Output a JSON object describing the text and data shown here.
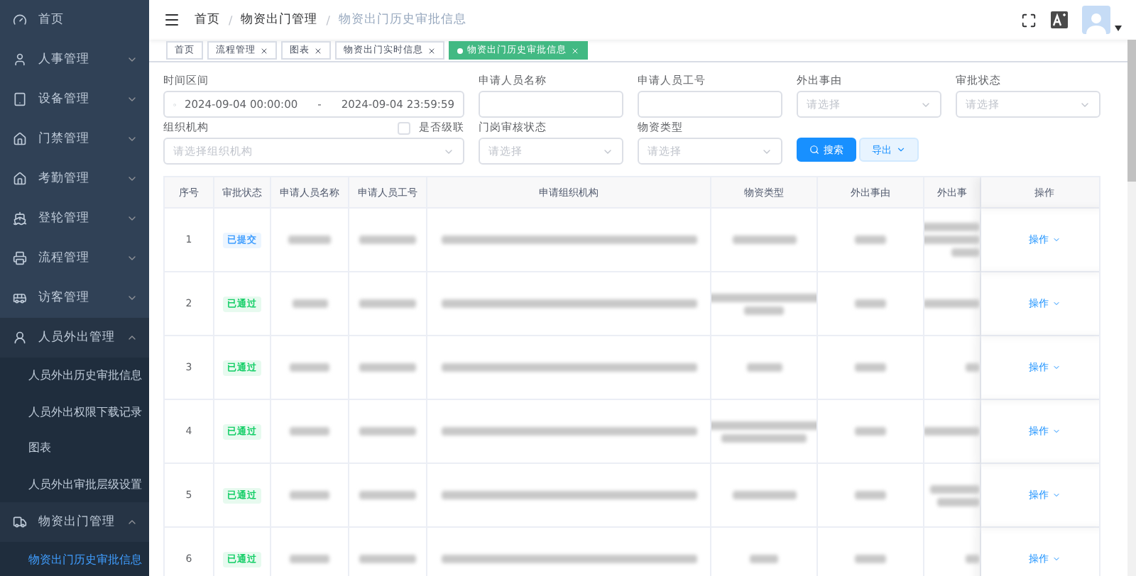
{
  "sidebar": {
    "items": [
      {
        "label": "首页"
      },
      {
        "label": "人事管理",
        "expanded": false
      },
      {
        "label": "设备管理",
        "expanded": false
      },
      {
        "label": "门禁管理",
        "expanded": false
      },
      {
        "label": "考勤管理",
        "expanded": false
      },
      {
        "label": "登轮管理",
        "expanded": false
      },
      {
        "label": "流程管理",
        "expanded": false
      },
      {
        "label": "访客管理",
        "expanded": false
      },
      {
        "label": "人员外出管理",
        "expanded": true,
        "children": [
          {
            "label": "人员外出历史审批信息",
            "selected": false
          },
          {
            "label": "人员外出权限下载记录",
            "selected": false
          },
          {
            "label": "图表",
            "selected": false
          },
          {
            "label": "人员外出审批层级设置",
            "selected": false
          }
        ]
      },
      {
        "label": "物资出门管理",
        "expanded": true,
        "children": [
          {
            "label": "物资出门历史审批信息",
            "selected": true
          }
        ]
      }
    ]
  },
  "breadcrumb": {
    "separator": "/",
    "items": [
      "首页",
      "物资出门管理",
      "物资出门历史审批信息"
    ]
  },
  "tags": [
    {
      "label": "首页",
      "closable": false,
      "selected": false
    },
    {
      "label": "流程管理",
      "closable": true,
      "selected": false
    },
    {
      "label": "图表",
      "closable": true,
      "selected": false
    },
    {
      "label": "物资出门实时信息",
      "closable": true,
      "selected": false
    },
    {
      "label": "物资出门历史审批信息",
      "closable": true,
      "selected": true
    }
  ],
  "filters": {
    "date_range": {
      "label": "时间区间",
      "start": "2024-09-04 00:00:00",
      "separator": "-",
      "end": "2024-09-04 23:59:59"
    },
    "row1": [
      {
        "label": "申请人员名称",
        "kind": "input"
      },
      {
        "label": "申请人员工号",
        "kind": "input"
      },
      {
        "label": "外出事由",
        "kind": "select",
        "placeholder": "请选择"
      },
      {
        "label": "审批状态",
        "kind": "select",
        "placeholder": "请选择"
      }
    ],
    "org": {
      "label": "组织机构",
      "placeholder": "请选择组织机构",
      "cascade": {
        "label": "是否级联",
        "checked": false
      }
    },
    "row2": [
      {
        "label": "门岗审核状态",
        "kind": "select",
        "placeholder": "请选择"
      },
      {
        "label": "物资类型",
        "kind": "select",
        "placeholder": "请选择"
      }
    ],
    "search_button": "搜索",
    "export_button": "导出"
  },
  "table": {
    "columns": [
      "序号",
      "审批状态",
      "申请人员名称",
      "申请人员工号",
      "申请组织机构",
      "物资类型",
      "外出事由",
      "外出事",
      "操作"
    ],
    "rows": [
      {
        "index": "1",
        "status": {
          "label": "已提交",
          "color": "#409eff"
        },
        "action": "操作"
      },
      {
        "index": "2",
        "status": {
          "label": "已通过",
          "color": "#13ce66"
        },
        "action": "操作"
      },
      {
        "index": "3",
        "status": {
          "label": "已通过",
          "color": "#13ce66"
        },
        "action": "操作"
      },
      {
        "index": "4",
        "status": {
          "label": "已通过",
          "color": "#13ce66"
        },
        "action": "操作"
      },
      {
        "index": "5",
        "status": {
          "label": "已通过",
          "color": "#13ce66"
        },
        "action": "操作"
      },
      {
        "index": "6",
        "status": {
          "label": "已通过",
          "color": "#13ce66"
        },
        "action": "操作"
      }
    ]
  }
}
